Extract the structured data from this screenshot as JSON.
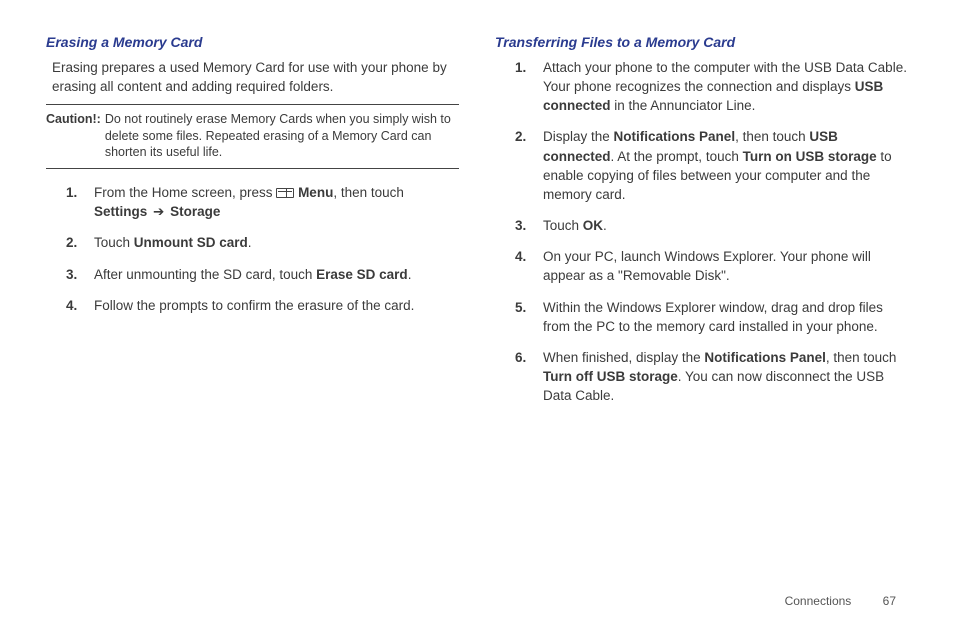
{
  "left": {
    "heading": "Erasing a Memory Card",
    "intro": "Erasing prepares a used Memory Card for use with your phone by erasing all content and adding required folders.",
    "caution_label": "Caution!:",
    "caution_text": "Do not routinely erase Memory Cards when you simply wish to delete some files. Repeated erasing of a Memory Card can shorten its useful life.",
    "steps": {
      "s1_a": "From the Home screen, press ",
      "s1_menu": " Menu",
      "s1_b": ", then touch ",
      "s1_settings": "Settings",
      "s1_arrow": " ➔ ",
      "s1_storage": "Storage",
      "s2_a": "Touch ",
      "s2_b": "Unmount SD card",
      "s2_c": ".",
      "s3_a": "After unmounting the SD card, touch ",
      "s3_b": "Erase SD card",
      "s3_c": ".",
      "s4": "Follow the prompts to confirm the erasure of the card."
    }
  },
  "right": {
    "heading": "Transferring Files to a Memory Card",
    "steps": {
      "s1_a": "Attach your phone to the computer with the USB Data Cable. Your phone recognizes the connection and displays ",
      "s1_b": "USB connected",
      "s1_c": " in the Annunciator Line.",
      "s2_a": "Display the ",
      "s2_b": "Notifications Panel",
      "s2_c": ", then touch ",
      "s2_d": "USB connected",
      "s2_e": ". At the prompt, touch ",
      "s2_f": "Turn on USB storage",
      "s2_g": " to enable copying of files between your computer and the memory card.",
      "s3_a": "Touch ",
      "s3_b": "OK",
      "s3_c": ".",
      "s4": "On your PC, launch Windows Explorer. Your phone will appear as a \"Removable Disk\".",
      "s5": "Within the Windows Explorer window, drag and drop files from the PC to the memory card installed in your phone.",
      "s6_a": "When finished, display the ",
      "s6_b": "Notifications Panel",
      "s6_c": ", then touch ",
      "s6_d": "Turn off USB storage",
      "s6_e": ". You can now disconnect the USB Data Cable."
    }
  },
  "footer": {
    "section": "Connections",
    "page": "67"
  }
}
